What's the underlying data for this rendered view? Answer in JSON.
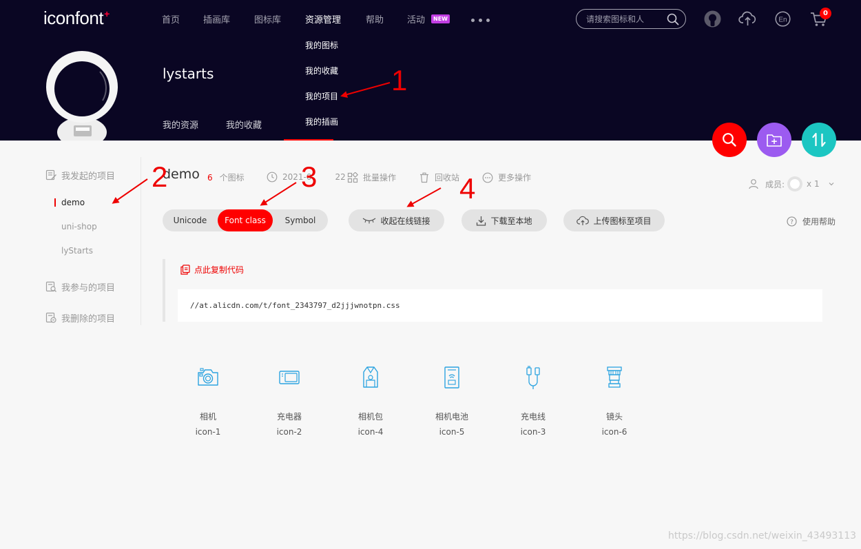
{
  "header": {
    "logo": "iconfont",
    "logo_mark": "+",
    "nav": [
      {
        "label": "首页"
      },
      {
        "label": "插画库"
      },
      {
        "label": "图标库"
      },
      {
        "label": "资源管理"
      },
      {
        "label": "帮助"
      },
      {
        "label": "活动"
      }
    ],
    "new_badge": "NEW",
    "search_placeholder": "请搜索图标和人",
    "cart_count": "0",
    "lang_icon_text": "En"
  },
  "dropdown": [
    {
      "label": "我的图标"
    },
    {
      "label": "我的收藏"
    },
    {
      "label": "我的项目"
    },
    {
      "label": "我的插画"
    }
  ],
  "profile": {
    "username": "lystarts",
    "tabs": [
      {
        "label": "我的资源"
      },
      {
        "label": "我的收藏"
      }
    ]
  },
  "sidebar": {
    "groups": [
      {
        "label": "我发起的项目"
      },
      {
        "label": "我参与的项目"
      },
      {
        "label": "我删除的项目"
      }
    ],
    "projects": [
      {
        "label": "demo"
      },
      {
        "label": "uni-shop"
      },
      {
        "label": "lyStarts"
      }
    ]
  },
  "project": {
    "name": "demo",
    "icon_count": "6",
    "icon_count_label": "个图标",
    "date": "2021-0",
    "date_tail": "22",
    "batch": "批量操作",
    "recycle": "回收站",
    "more": "更多操作",
    "members_label": "成员:",
    "members_count": "x 1"
  },
  "toolbar": {
    "tabs": [
      {
        "label": "Unicode"
      },
      {
        "label": "Font class"
      },
      {
        "label": "Symbol"
      }
    ],
    "collapse_link": "收起在线链接",
    "download": "下载至本地",
    "upload": "上传图标至项目",
    "help": "使用帮助"
  },
  "code": {
    "copy_label": "点此复制代码",
    "url": "//at.alicdn.com/t/font_2343797_d2jjjwnotpn.css"
  },
  "icons": [
    {
      "name": "相机",
      "class": "icon-1"
    },
    {
      "name": "充电器",
      "class": "icon-2"
    },
    {
      "name": "相机包",
      "class": "icon-4"
    },
    {
      "name": "相机电池",
      "class": "icon-5"
    },
    {
      "name": "充电线",
      "class": "icon-3"
    },
    {
      "name": "镜头",
      "class": "icon-6"
    }
  ],
  "annotations": [
    "1",
    "2",
    "3",
    "4"
  ],
  "watermark": "https://blog.csdn.net/weixin_43493113",
  "colors": {
    "header_bg": "#0a0623",
    "accent": "#ff0000",
    "fab_search": "#ff0000",
    "fab_folder": "#9c5bf0",
    "fab_sort": "#1cc6c2",
    "icon_blue": "#2ba3e0"
  },
  "icon_names": [
    "search-icon",
    "upload-cloud-icon",
    "cart-icon",
    "github-icon",
    "folder-add-icon",
    "sort-icon",
    "clock-icon",
    "trash-icon"
  ]
}
